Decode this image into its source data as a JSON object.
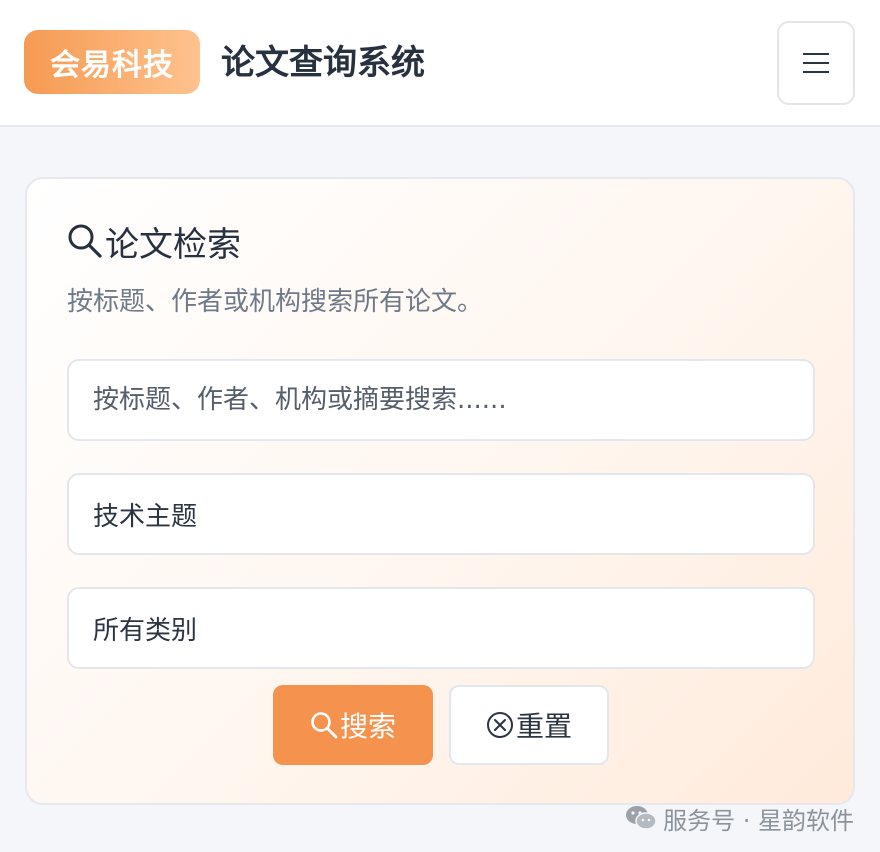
{
  "header": {
    "logo_text": "会易科技",
    "title": "论文查询系统",
    "menu_icon": "hamburger-menu-icon"
  },
  "search_card": {
    "title": "论文检索",
    "title_icon": "search-icon",
    "subtitle": "按标题、作者或机构搜索所有论文。",
    "keyword_input": {
      "value": "",
      "placeholder": "按标题、作者、机构或摘要搜索......"
    },
    "topic_select": {
      "value": "技术主题"
    },
    "category_select": {
      "value": "所有类别"
    },
    "search_button": {
      "label": "搜索",
      "icon": "search-icon"
    },
    "reset_button": {
      "label": "重置",
      "icon": "close-circle-icon"
    }
  },
  "watermark": {
    "text": "服务号 · 星韵软件",
    "icon": "wechat-icon"
  },
  "colors": {
    "accent": "#f5924e",
    "logo_gradient_start": "#f59a52",
    "logo_gradient_end": "#ffc28e",
    "text_primary": "#27313f",
    "text_muted": "#6f7a88"
  }
}
